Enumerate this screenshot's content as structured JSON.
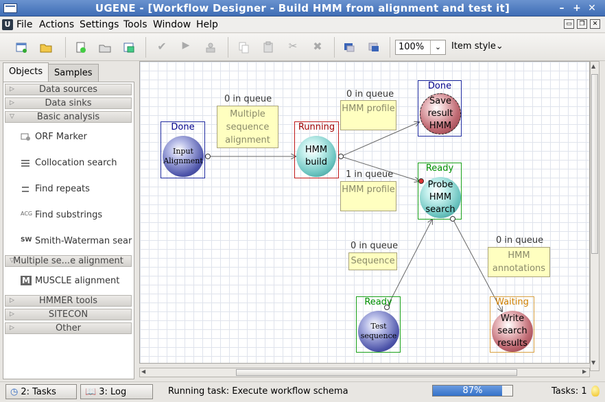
{
  "window": {
    "title": "UGENE - [Workflow Designer - Build HMM from alignment and test it]",
    "min": "–",
    "max": "+",
    "close": "✕"
  },
  "menu": [
    "File",
    "Actions",
    "Settings",
    "Tools",
    "Window",
    "Help"
  ],
  "toolbar": {
    "zoom": "100%",
    "item_style": "Item style"
  },
  "tabs": {
    "objects": "Objects",
    "samples": "Samples"
  },
  "groups": {
    "data_sources": "Data sources",
    "data_sinks": "Data sinks",
    "basic_analysis": "Basic analysis",
    "multiple_alignment": "Multiple se...e alignment",
    "hmmer": "HMMER tools",
    "sitecon": "SITECON",
    "other": "Other"
  },
  "items": {
    "orf": "ORF Marker",
    "colloc": "Collocation search",
    "repeats": "Find repeats",
    "substr": "Find substrings",
    "sw": "Smith-Waterman sear",
    "muscle": "MUSCLE alignment"
  },
  "workflow": {
    "input": {
      "status": "Done",
      "label": "Input Alignment"
    },
    "hmmbuild": {
      "status": "Running",
      "label": "HMM build"
    },
    "save": {
      "status": "Done",
      "label": "Save result HMM"
    },
    "probe": {
      "status": "Ready",
      "label": "Probe HMM search"
    },
    "testseq": {
      "status": "Ready",
      "label": "Test sequence"
    },
    "write": {
      "status": "Waiting",
      "label": "Write search results"
    },
    "notes": {
      "msa": "Multiple sequence alignment",
      "hmm1": "HMM profile",
      "hmm2": "HMM profile",
      "seq": "Sequence",
      "ann": "HMM annotations"
    },
    "queues": {
      "q1": "0 in queue",
      "q2": "0 in queue",
      "q3": "1 in queue",
      "q4": "0 in queue",
      "q5": "0 in queue"
    }
  },
  "status": {
    "tasks_btn": "2: Tasks",
    "log_btn": "3: Log",
    "running": "Running task: Execute workflow schema",
    "progress": 87,
    "progress_label": "87%",
    "tasks_count": "Tasks: 1"
  },
  "colors": {
    "done": "#00008b",
    "running": "#a00000",
    "ready": "#009000",
    "waiting": "#d08000"
  }
}
